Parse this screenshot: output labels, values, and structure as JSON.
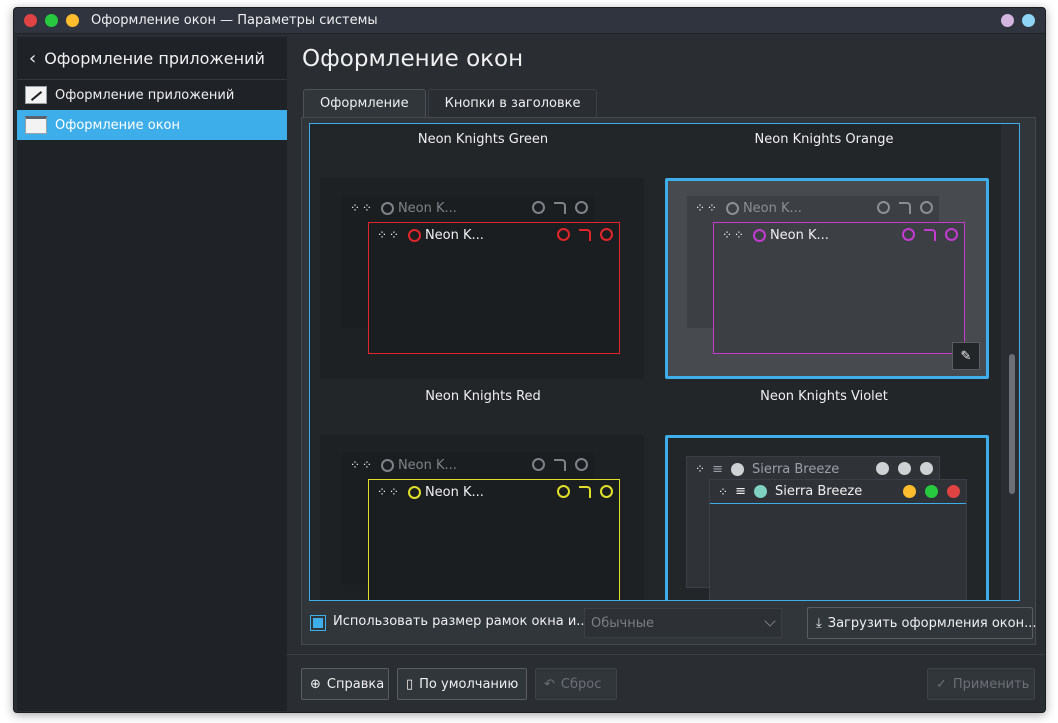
{
  "window": {
    "title": "Оформление окон — Параметры системы",
    "controls": {
      "close_color": "#e04343",
      "maximize_color": "#27c93f",
      "minimize_color": "#ffbd2e",
      "right_a": "#d3b5e0",
      "right_b": "#8fd3f5"
    }
  },
  "sidebar": {
    "header": "Оформление приложений",
    "items": [
      {
        "label": "Оформление приложений",
        "icon": "brush-icon",
        "active": false
      },
      {
        "label": "Оформление окон",
        "icon": "window-icon",
        "active": true
      }
    ]
  },
  "main": {
    "title": "Оформление окон",
    "tabs": [
      {
        "label": "Оформление",
        "active": true
      },
      {
        "label": "Кнопки в заголовке",
        "active": false
      }
    ],
    "themes": [
      {
        "name": "Neon Knights Green",
        "back_label": "Neon K...",
        "front_label": "Neon K...",
        "accent": "#e0262b",
        "selected": false
      },
      {
        "name": "Neon Knights Orange",
        "back_label": "Neon K...",
        "front_label": "Neon K...",
        "accent": "#c43bd1",
        "selected": true
      },
      {
        "name": "Neon Knights Red",
        "back_label": "Neon K...",
        "front_label": "Neon K...",
        "accent": "#e0e02a",
        "selected": false
      },
      {
        "name": "Neon Knights Violet",
        "back_label": "Sierra Breeze",
        "front_label": "Sierra Breeze",
        "accent": "#3daee9",
        "selected": true
      }
    ],
    "use_border_size_label": "Использовать размер рамок окна и...",
    "border_size_value": "Обычные",
    "download_label": "Загрузить оформления окон..."
  },
  "footer": {
    "help_label": "Справка",
    "defaults_label": "По умолчанию",
    "reset_label": "Сброс",
    "apply_label": "Применить"
  }
}
